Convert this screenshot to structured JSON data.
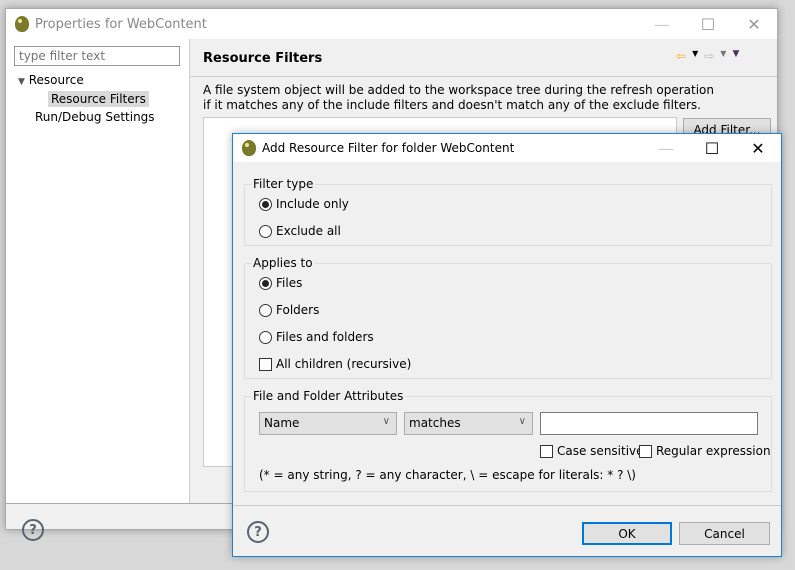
{
  "outer": {
    "title": "Properties for WebContent",
    "filter_placeholder": "type filter text",
    "tree": [
      {
        "label": "Resource"
      },
      {
        "label": "Resource Filters"
      },
      {
        "label": "Run/Debug Settings"
      }
    ],
    "page_title": "Resource Filters",
    "description_1": "A file system object will be added to the workspace tree during the refresh operation",
    "description_2": "if it matches any of the include filters and doesn't match any of the exclude filters.",
    "add_filter_label": "Add Filter..."
  },
  "dialog": {
    "title": "Add Resource Filter for folder WebContent",
    "filter_type": {
      "legend": "Filter type",
      "options": [
        "Include only",
        "Exclude all"
      ],
      "selected": "Include only"
    },
    "applies_to": {
      "legend": "Applies to",
      "options": [
        "Files",
        "Folders",
        "Files and folders"
      ],
      "selected": "Files",
      "recursive_label": "All children (recursive)",
      "recursive_checked": false
    },
    "attributes": {
      "legend": "File and Folder Attributes",
      "attribute": "Name",
      "operator": "matches",
      "value": "",
      "case_sensitive_label": "Case sensitive",
      "regex_label": "Regular expression",
      "hint": "(* = any string, ? = any character, \\ = escape for literals: * ? \\)"
    },
    "ok_label": "OK",
    "cancel_label": "Cancel"
  },
  "colors": {
    "accent": "#0078d7",
    "nav_back": "#e8b030"
  }
}
